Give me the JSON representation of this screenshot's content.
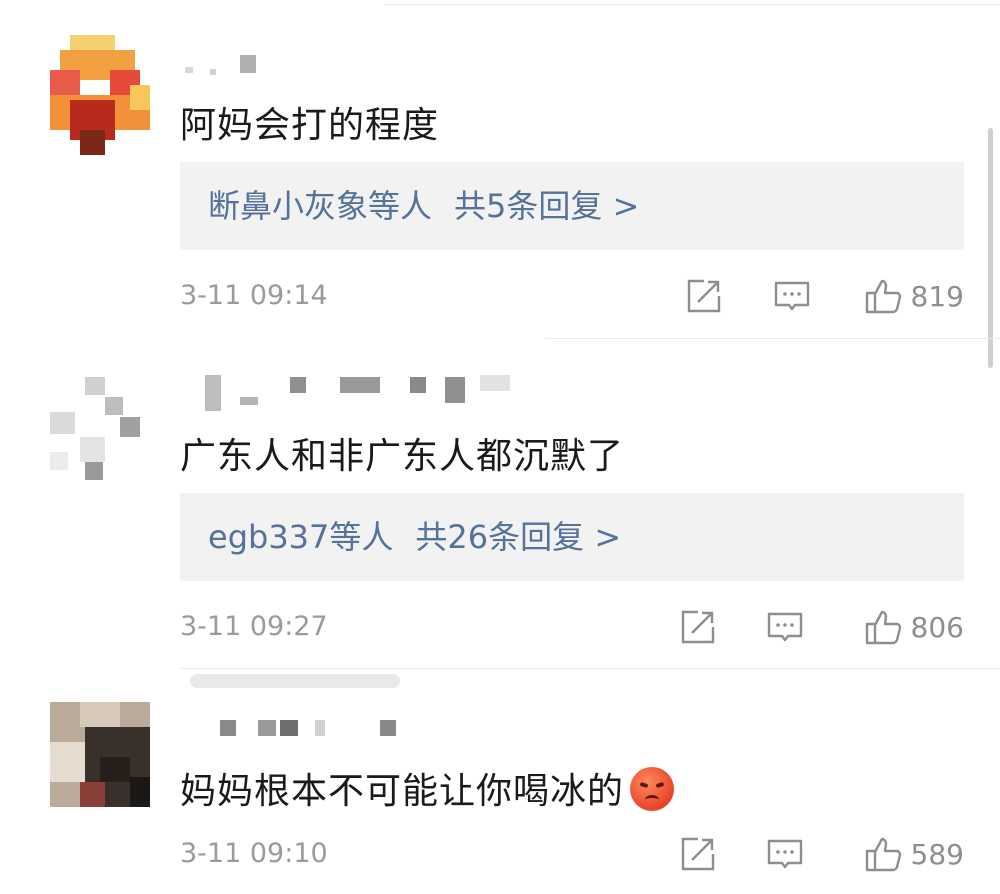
{
  "comments": [
    {
      "content": "阿妈会打的程度",
      "reply_users": "断鼻小灰象等人",
      "reply_count": "共5条回复",
      "reply_arrow": ">",
      "time": "3-11 09:14",
      "likes": "819"
    },
    {
      "content": "广东人和非广东人都沉默了",
      "reply_users": "egb337等人",
      "reply_count": "共26条回复",
      "reply_arrow": ">",
      "time": "3-11 09:27",
      "likes": "806"
    },
    {
      "content": "妈妈根本不可能让你喝冰的",
      "emoji": "angry-face-emoji",
      "time": "3-11 09:10",
      "likes": "589"
    }
  ],
  "icons": {
    "share": "share-icon",
    "comment": "comment-icon",
    "like": "thumbs-up-icon"
  },
  "colors": {
    "link": "#557298",
    "meta": "#9a9a9a",
    "reply_bg": "#f2f2f2"
  }
}
